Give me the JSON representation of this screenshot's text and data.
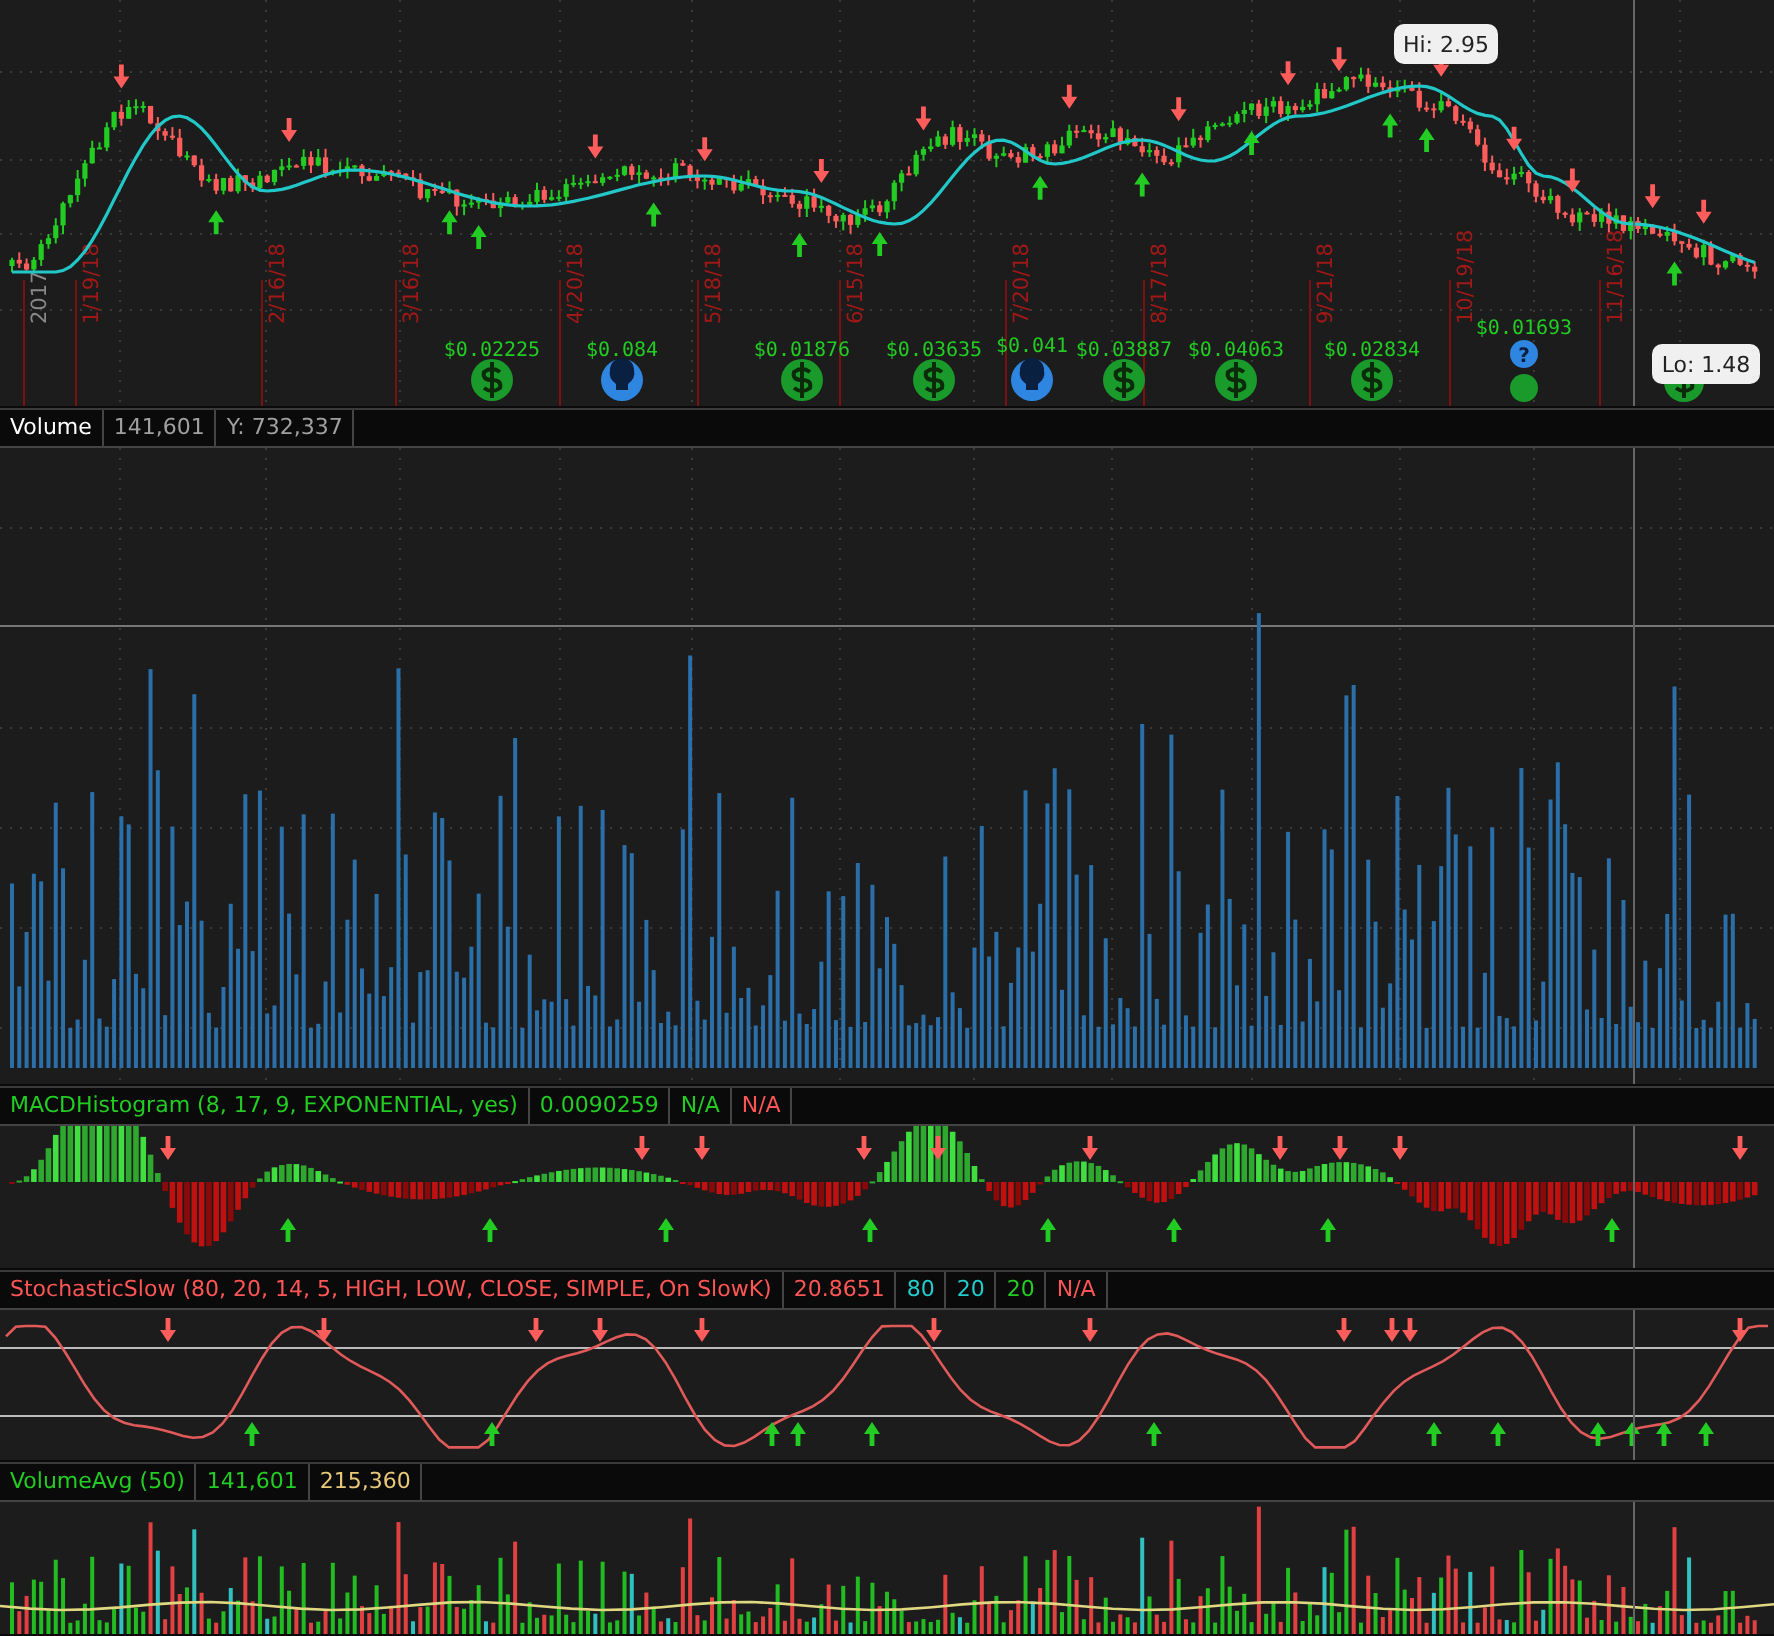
{
  "price_panel": {
    "hi_label": "Hi: 2.95",
    "lo_label": "Lo: 1.48",
    "date_labels": [
      {
        "kind": "year",
        "text": "2017"
      },
      {
        "kind": "date",
        "text": "1/19/18"
      },
      {
        "kind": "date",
        "text": "2/16/18"
      },
      {
        "kind": "date",
        "text": "3/16/18"
      },
      {
        "kind": "date",
        "text": "4/20/18"
      },
      {
        "kind": "date",
        "text": "5/18/18"
      },
      {
        "kind": "date",
        "text": "6/15/18"
      },
      {
        "kind": "date",
        "text": "7/20/18"
      },
      {
        "kind": "date",
        "text": "8/17/18"
      },
      {
        "kind": "date",
        "text": "9/21/18"
      },
      {
        "kind": "date",
        "text": "10/19/18"
      },
      {
        "kind": "date",
        "text": "11/16/18"
      }
    ],
    "events": [
      {
        "kind": "dividend",
        "amount": "$0.02225"
      },
      {
        "kind": "earnings",
        "amount": "$0.084"
      },
      {
        "kind": "dividend",
        "amount": "$0.01876"
      },
      {
        "kind": "dividend",
        "amount": "$0.03635"
      },
      {
        "kind": "earnings",
        "amount": "$0.041"
      },
      {
        "kind": "dividend",
        "amount": "$0.03887"
      },
      {
        "kind": "dividend",
        "amount": "$0.04063"
      },
      {
        "kind": "dividend",
        "amount": "$0.02834"
      },
      {
        "kind": "unconfirmed",
        "amount": "$0.01693",
        "badge": "?"
      },
      {
        "kind": "dividend"
      }
    ]
  },
  "studies": [
    {
      "kind": "volume",
      "fields": [
        "Volume",
        "141,601",
        "Y: 732,337"
      ]
    },
    {
      "kind": "macd",
      "fields": [
        "MACDHistogram (8, 17, 9, EXPONENTIAL, yes)",
        "0.0090259",
        "N/A",
        "N/A"
      ]
    },
    {
      "kind": "stochastic",
      "fields": [
        "StochasticSlow (80, 20, 14, 5, HIGH, LOW, CLOSE, SIMPLE, On SlowK)",
        "20.8651",
        "80",
        "20",
        "20",
        "N/A"
      ]
    },
    {
      "kind": "volume_avg",
      "fields": [
        "VolumeAvg (50)",
        "141,601",
        "215,360"
      ]
    }
  ]
}
